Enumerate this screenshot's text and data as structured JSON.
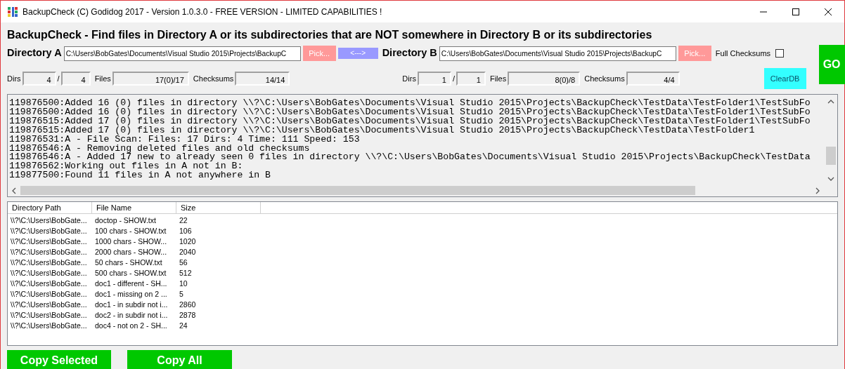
{
  "window": {
    "title": "BackupCheck (C) Godidog 2017 - Version 1.0.3.0 - FREE VERSION - LIMITED CAPABILITIES !"
  },
  "heading": "BackupCheck - Find files in Directory A or its subdirectories that are NOT somewhere in Directory B or its subdirectories",
  "directory_a": {
    "label": "Directory A",
    "path": "C:\\Users\\BobGates\\Documents\\Visual Studio 2015\\Projects\\BackupC",
    "pick_button": "Pick..."
  },
  "swap_button": "<--->",
  "directory_b": {
    "label": "Directory B",
    "path": "C:\\Users\\BobGates\\Documents\\Visual Studio 2015\\Projects\\BackupC",
    "pick_button": "Pick..."
  },
  "full_checksums": {
    "label": "Full Checksums",
    "checked": false
  },
  "go_button": "GO",
  "clear_db_button": "ClearDB",
  "stats_a": {
    "dirs_label": "Dirs",
    "dirs_1": "4",
    "separator": "/",
    "dirs_2": "4",
    "files_label": "Files",
    "files": "17(0)/17",
    "checksums_label": "Checksums",
    "checksums": "14/14"
  },
  "stats_b": {
    "dirs_label": "Dirs",
    "dirs_1": "1",
    "separator": "/",
    "dirs_2": "1",
    "files_label": "Files",
    "files": "8(0)/8",
    "checksums_label": "Checksums",
    "checksums": "4/4"
  },
  "log": {
    "lines": [
      "119876500:Added 16 (0) files in directory \\\\?\\C:\\Users\\BobGates\\Documents\\Visual Studio 2015\\Projects\\BackupCheck\\TestData\\TestFolder1\\TestSubFo",
      "119876500:Added 16 (0) files in directory \\\\?\\C:\\Users\\BobGates\\Documents\\Visual Studio 2015\\Projects\\BackupCheck\\TestData\\TestFolder1\\TestSubFo",
      "119876515:Added 17 (0) files in directory \\\\?\\C:\\Users\\BobGates\\Documents\\Visual Studio 2015\\Projects\\BackupCheck\\TestData\\TestFolder1\\TestSubFo",
      "119876515:Added 17 (0) files in directory \\\\?\\C:\\Users\\BobGates\\Documents\\Visual Studio 2015\\Projects\\BackupCheck\\TestData\\TestFolder1",
      "119876531:A - File Scan: Files: 17 Dirs: 4 Time: 111 Speed: 153",
      "119876546:A - Removing deleted files and old checksums",
      "119876546:A - Added 17 new to already seen 0 files in directory \\\\?\\C:\\Users\\BobGates\\Documents\\Visual Studio 2015\\Projects\\BackupCheck\\TestData",
      "119876562:Working out files in A not in B:",
      "119877500:Found 11 files in A not anywhere in B"
    ]
  },
  "table": {
    "columns": [
      "Directory Path",
      "File Name",
      "Size"
    ],
    "rows": [
      [
        "\\\\?\\C:\\Users\\BobGate...",
        "doctop - SHOW.txt",
        "22"
      ],
      [
        "\\\\?\\C:\\Users\\BobGate...",
        "100 chars - SHOW.txt",
        "106"
      ],
      [
        "\\\\?\\C:\\Users\\BobGate...",
        "1000 chars - SHOW...",
        "1020"
      ],
      [
        "\\\\?\\C:\\Users\\BobGate...",
        "2000 chars - SHOW...",
        "2040"
      ],
      [
        "\\\\?\\C:\\Users\\BobGate...",
        "50 chars - SHOW.txt",
        "56"
      ],
      [
        "\\\\?\\C:\\Users\\BobGate...",
        "500 chars - SHOW.txt",
        "512"
      ],
      [
        "\\\\?\\C:\\Users\\BobGate...",
        "doc1 - different - SH...",
        "10"
      ],
      [
        "\\\\?\\C:\\Users\\BobGate...",
        "doc1 - missing on 2 ...",
        "5"
      ],
      [
        "\\\\?\\C:\\Users\\BobGate...",
        "doc1 - in subdir not i...",
        "2860"
      ],
      [
        "\\\\?\\C:\\Users\\BobGate...",
        "doc2 - in subdir not i...",
        "2878"
      ],
      [
        "\\\\?\\C:\\Users\\BobGate...",
        "doc4 - not on 2 - SH...",
        "24"
      ]
    ]
  },
  "buttons": [
    "Copy Selected",
    "Copy All"
  ]
}
